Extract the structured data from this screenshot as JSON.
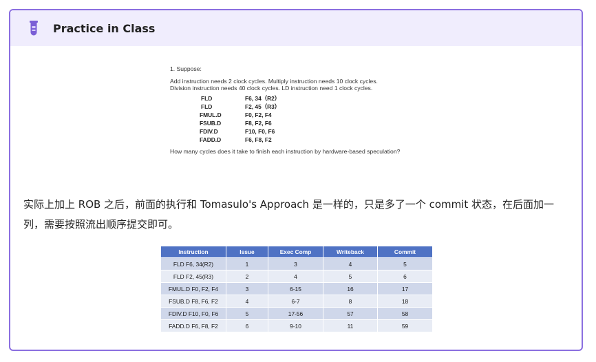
{
  "card": {
    "title": "Practice in Class",
    "icon": "flask-icon",
    "accent_color": "#8b6fe0",
    "header_bg": "#f0edfd"
  },
  "problem": {
    "intro": "1. Suppose:",
    "line1": "Add instruction needs 2 clock cycles. Multiply instruction needs 10 clock cycles.",
    "line2": "Division instruction needs 40 clock cycles. LD instruction need 1 clock cycles.",
    "code": [
      {
        "op": "FLD",
        "args": "F6, 34（R2）"
      },
      {
        "op": "FLD",
        "args": "F2, 45（R3）"
      },
      {
        "op": "FMUL.D",
        "args": "F0, F2, F4"
      },
      {
        "op": "FSUB.D",
        "args": "F8, F2, F6"
      },
      {
        "op": "FDIV.D",
        "args": "F10, F0, F6"
      },
      {
        "op": "FADD.D",
        "args": "F6, F8, F2"
      }
    ],
    "question": "How many cycles does it take to finish each instruction by hardware-based speculation?"
  },
  "paragraph": "实际上加上 ROB 之后，前面的执行和 Tomasulo's Approach 是一样的，只是多了一个 commit 状态，在后面加一列，需要按照流出顺序提交即可。",
  "table": {
    "header_color": "#4f72c4",
    "headers": [
      "Instruction",
      "Issue",
      "Exec Comp",
      "Writeback",
      "Commit"
    ],
    "rows": [
      [
        "FLD F6, 34(R2)",
        "1",
        "3",
        "4",
        "5"
      ],
      [
        "FLD F2, 45(R3)",
        "2",
        "4",
        "5",
        "6"
      ],
      [
        "FMUL.D F0, F2, F4",
        "3",
        "6-15",
        "16",
        "17"
      ],
      [
        "FSUB.D F8, F6, F2",
        "4",
        "6-7",
        "8",
        "18"
      ],
      [
        "FDIV.D F10, F0, F6",
        "5",
        "17-56",
        "57",
        "58"
      ],
      [
        "FADD.D F6, F8, F2",
        "6",
        "9-10",
        "11",
        "59"
      ]
    ]
  }
}
